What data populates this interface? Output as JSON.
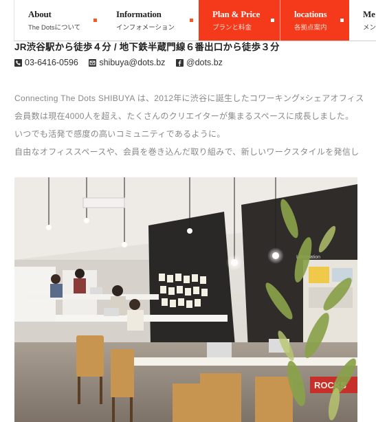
{
  "nav": {
    "items": [
      {
        "en": "About",
        "jp": "The Dotsについて"
      },
      {
        "en": "Information",
        "jp": "インフォメーション"
      },
      {
        "en": "Plan & Price",
        "jp": "プランと料金"
      },
      {
        "en": "locations",
        "jp": "各拠点案内"
      },
      {
        "en": "Me",
        "jp": "メン"
      }
    ],
    "active_color": "#f43a1a"
  },
  "access": "JR渋谷駅から徒歩４分 / 地下鉄半蔵門線６番出口から徒歩３分",
  "contacts": {
    "phone": "03-6416-0596",
    "email": "shibuya@dots.bz",
    "facebook": "@dots.bz"
  },
  "description": [
    "Connecting The Dots SHIBUYA は、2012年に渋谷に誕生したコワーキング×シェアオフィス",
    "会員数は現在4000人を超え、たくさんのクリエイターが集まるスペースに成長しました。",
    "いつでも活発で感度の高いコミュニティであるように。",
    "自由なオフィススペースや、会員を巻き込んだ取り組みで、新しいワークスタイルを発信し"
  ],
  "photo": {
    "sign_text": "Information",
    "banner_text": "ROCKS"
  }
}
